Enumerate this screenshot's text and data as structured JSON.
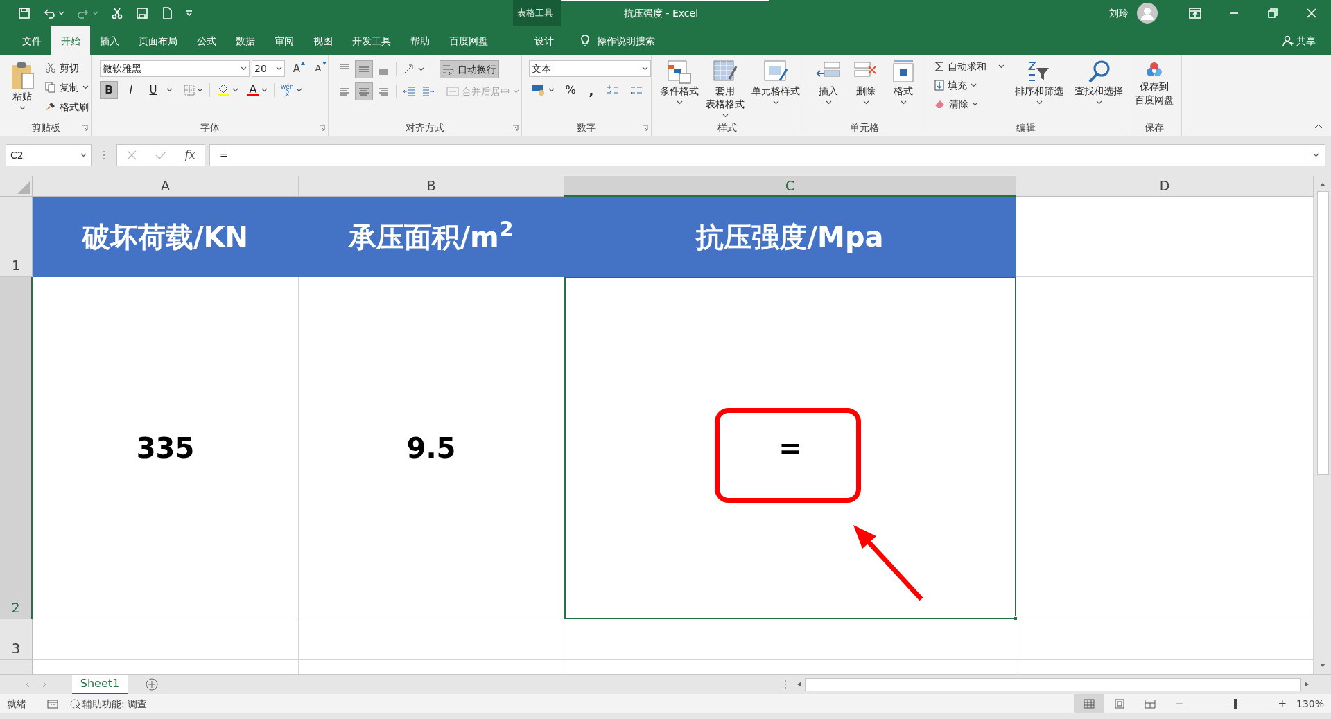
{
  "title_bar": {
    "title": "抗压强度 - Excel",
    "user": "刘玲"
  },
  "ribbon_tabs": [
    {
      "label": "文件",
      "selected": false
    },
    {
      "label": "开始",
      "selected": true
    },
    {
      "label": "插入",
      "selected": false
    },
    {
      "label": "页面布局",
      "selected": false
    },
    {
      "label": "公式",
      "selected": false
    },
    {
      "label": "数据",
      "selected": false
    },
    {
      "label": "审阅",
      "selected": false
    },
    {
      "label": "视图",
      "selected": false
    },
    {
      "label": "开发工具",
      "selected": false
    },
    {
      "label": "帮助",
      "selected": false
    },
    {
      "label": "百度网盘",
      "selected": false
    }
  ],
  "contextual_tabs": {
    "label": "表格工具",
    "tabs": [
      {
        "label": "设计",
        "selected": false
      }
    ]
  },
  "tell_me": "操作说明搜索",
  "share": "共享",
  "clipboard": {
    "label": "剪贴板",
    "paste": "粘贴",
    "cut": "剪切",
    "copy": "复制",
    "format_painter": "格式刷"
  },
  "font": {
    "label": "字体",
    "font_name": "微软雅黑",
    "font_size": "20",
    "grow": "A",
    "shrink": "A",
    "styles": [
      {
        "text": "B",
        "pressed": true
      },
      {
        "text": "I",
        "pressed": false
      },
      {
        "text": "U",
        "pressed": false
      }
    ],
    "font_color": "A",
    "phonetic_top": "wén",
    "phonetic_bottom": "文"
  },
  "alignment": {
    "label": "对齐方式",
    "vertical_align": [
      {
        "selected": false
      },
      {
        "selected": true
      },
      {
        "selected": false
      }
    ],
    "horizontal_align": [
      {
        "selected": false
      },
      {
        "selected": true
      },
      {
        "selected": false
      }
    ],
    "wrap_text": {
      "label": "自动换行",
      "pressed": true
    },
    "merge": {
      "label": "合并后居中",
      "disabled": true
    }
  },
  "number": {
    "label": "数字",
    "format": "文本",
    "percent": "%",
    "comma": ","
  },
  "styles": {
    "label": "样式",
    "buttons": [
      {
        "lines": [
          "条件格式"
        ]
      },
      {
        "lines": [
          "套用",
          "表格格式"
        ]
      },
      {
        "lines": [
          "单元格样式"
        ]
      }
    ]
  },
  "cells": {
    "label": "单元格",
    "buttons": [
      "插入",
      "删除",
      "格式"
    ]
  },
  "editing": {
    "label": "编辑",
    "autosum": "自动求和",
    "fill": "填充",
    "clear": "清除",
    "sort": "排序和筛选",
    "find": "查找和选择"
  },
  "save": {
    "label": "保存",
    "lines": [
      "保存到",
      "百度网盘"
    ]
  },
  "formula_bar": {
    "name_box": "C2",
    "fx": "fx",
    "formula": "="
  },
  "columns": [
    {
      "label": "A",
      "selected": false
    },
    {
      "label": "B",
      "selected": false
    },
    {
      "label": "C",
      "selected": true
    },
    {
      "label": "D",
      "selected": false
    }
  ],
  "rows": [
    {
      "header": "1",
      "kind": "header",
      "selected": false,
      "cells": [
        {
          "text": "破坏荷载/KN",
          "selected": false
        },
        {
          "text": "承压面积/m$^{2}$",
          "selected": false
        },
        {
          "text": "抗压强度/Mpa",
          "selected": false
        }
      ]
    },
    {
      "header": "2",
      "kind": "data",
      "selected": true,
      "cells": [
        {
          "text": "335",
          "selected": false
        },
        {
          "text": "9.5",
          "selected": false
        },
        {
          "text": "=",
          "selected": true
        }
      ]
    },
    {
      "header": "3",
      "kind": "data",
      "selected": false
    }
  ],
  "sheet_tabs": [
    {
      "label": "Sheet1",
      "selected": true
    }
  ],
  "status_bar": {
    "ready": "就绪",
    "accessibility": "辅助功能: 调查",
    "views": [
      {
        "selected": true
      },
      {
        "selected": false
      },
      {
        "selected": false
      }
    ],
    "minus": "−",
    "plus": "+",
    "zoom": {
      "level": 0.56
    },
    "zoom_text": "130%"
  }
}
